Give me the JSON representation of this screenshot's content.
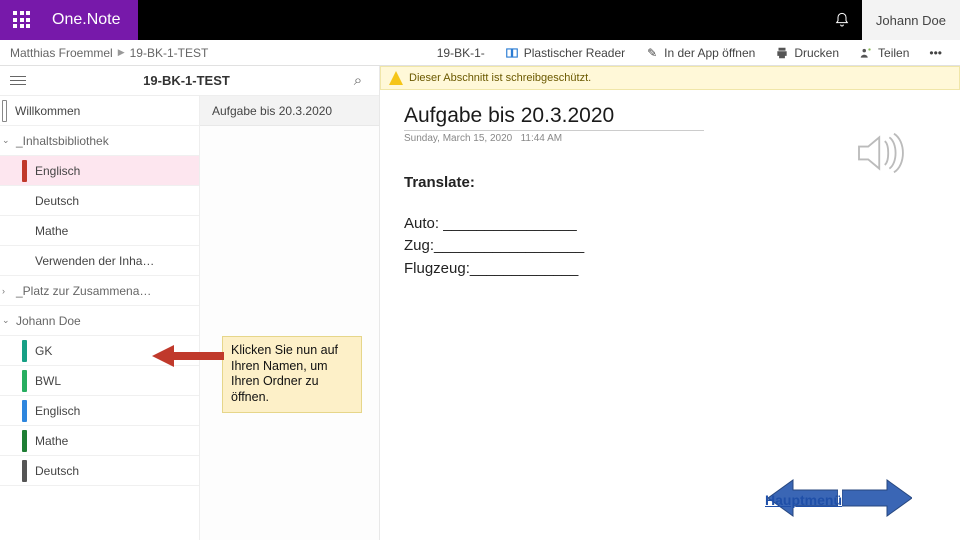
{
  "header": {
    "app_name": "One.Note",
    "user": "Johann Doe"
  },
  "breadcrumb": {
    "owner": "Matthias Froemmel",
    "notebook": "19-BK-1-TEST"
  },
  "toolbar": {
    "tab": "19-BK-1-",
    "reader": "Plastischer Reader",
    "open_app": "In der App öffnen",
    "print": "Drucken",
    "share": "Teilen"
  },
  "notebook_title": "19-BK-1-TEST",
  "warning": "Dieser Abschnitt ist schreibgeschützt.",
  "sections": [
    {
      "type": "item",
      "label": "Willkommen",
      "tab": "t-gray"
    },
    {
      "type": "group",
      "label": "_Inhaltsbibliothek",
      "expand": "⌄"
    },
    {
      "type": "sub",
      "label": "Englisch",
      "tab": "t-red",
      "active": true
    },
    {
      "type": "sub",
      "label": "Deutsch",
      "tab": "t-none"
    },
    {
      "type": "sub",
      "label": "Mathe",
      "tab": "t-none"
    },
    {
      "type": "sub",
      "label": "Verwenden der Inha…",
      "tab": "t-none"
    },
    {
      "type": "group",
      "label": "_Platz zur Zusammena…",
      "expand": "›"
    },
    {
      "type": "group",
      "label": "Johann Doe",
      "expand": "⌄"
    },
    {
      "type": "sub",
      "label": "GK",
      "tab": "t-teal"
    },
    {
      "type": "sub",
      "label": "BWL",
      "tab": "t-green"
    },
    {
      "type": "sub",
      "label": "Englisch",
      "tab": "t-blue"
    },
    {
      "type": "sub",
      "label": "Mathe",
      "tab": "t-dgreen"
    },
    {
      "type": "sub",
      "label": "Deutsch",
      "tab": "t-dgray"
    }
  ],
  "page_list": {
    "current": "Aufgabe bis 20.3.2020"
  },
  "doc": {
    "title": "Aufgabe bis 20.3.2020",
    "date": "Sunday, March 15, 2020",
    "time": "11:44 AM",
    "translate_label": "Translate:",
    "lines": [
      "Auto: ________________",
      "Zug:__________________",
      "Flugzeug:_____________"
    ]
  },
  "callout": "Klicken Sie nun auf Ihren Namen, um Ihren Ordner zu öffnen.",
  "nav": {
    "menu": "Hauptmenü"
  }
}
